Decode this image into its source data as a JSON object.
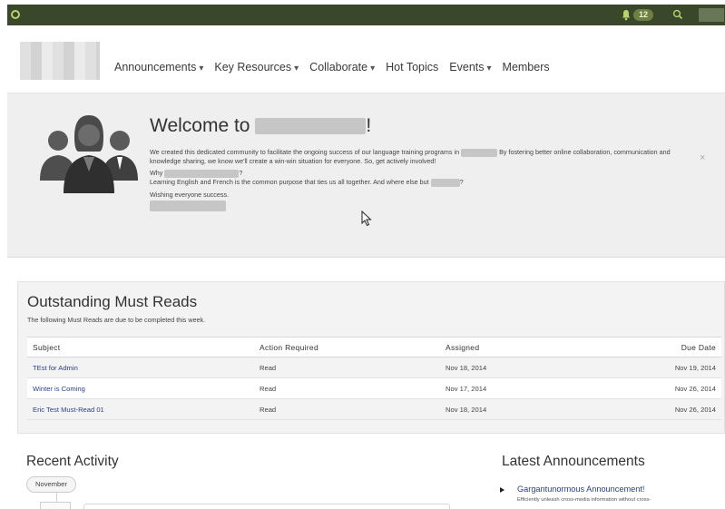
{
  "topbar": {
    "notification_count": "12",
    "icons": [
      "app-logo-icon",
      "bell-icon",
      "search-icon",
      "chevron-down-icon"
    ],
    "colors": {
      "bar": "#3b472b",
      "accent": "#b7d36b"
    }
  },
  "nav": {
    "items": [
      {
        "label": "Announcements",
        "dropdown": true
      },
      {
        "label": "Key Resources",
        "dropdown": true
      },
      {
        "label": "Collaborate",
        "dropdown": true
      },
      {
        "label": "Hot Topics",
        "dropdown": false
      },
      {
        "label": "Events",
        "dropdown": true
      },
      {
        "label": "Members",
        "dropdown": false
      }
    ],
    "caret": "▾"
  },
  "welcome": {
    "title_prefix": "Welcome to",
    "title_suffix": "!",
    "para1_start": "We created this dedicated community to facilitate the ongoing success of our language training programs in",
    "para1_end": "By fostering better online collaboration, communication and knowledge sharing, we know we'll create a win-win situation for everyone. So, get actively involved!",
    "why_prefix": "Why",
    "why_suffix": "?",
    "para2": "Learning English and French is the common purpose that ties us all together. And where else but",
    "para2_suffix": "?",
    "closing": "Wishing everyone success.",
    "close": "×"
  },
  "must_reads": {
    "title": "Outstanding Must Reads",
    "subtitle": "The following Must Reads are due to be completed this week.",
    "columns": [
      "Subject",
      "Action Required",
      "Assigned",
      "Due Date"
    ],
    "rows": [
      {
        "subject": "TEst for Admin",
        "action": "Read",
        "assigned": "Nov 18, 2014",
        "due": "Nov 19, 2014"
      },
      {
        "subject": "Winter is Coming",
        "action": "Read",
        "assigned": "Nov 17, 2014",
        "due": "Nov 26, 2014"
      },
      {
        "subject": "Eric Test Must-Read 01",
        "action": "Read",
        "assigned": "Nov 18, 2014",
        "due": "Nov 26, 2014"
      }
    ]
  },
  "recent_activity": {
    "title": "Recent Activity",
    "month": "November"
  },
  "latest_announcements": {
    "title": "Latest Announcements",
    "items": [
      {
        "title": "Gargantunormous Announcement!",
        "snippet": "Efficiently unleash cross-media information without cross-"
      }
    ]
  }
}
